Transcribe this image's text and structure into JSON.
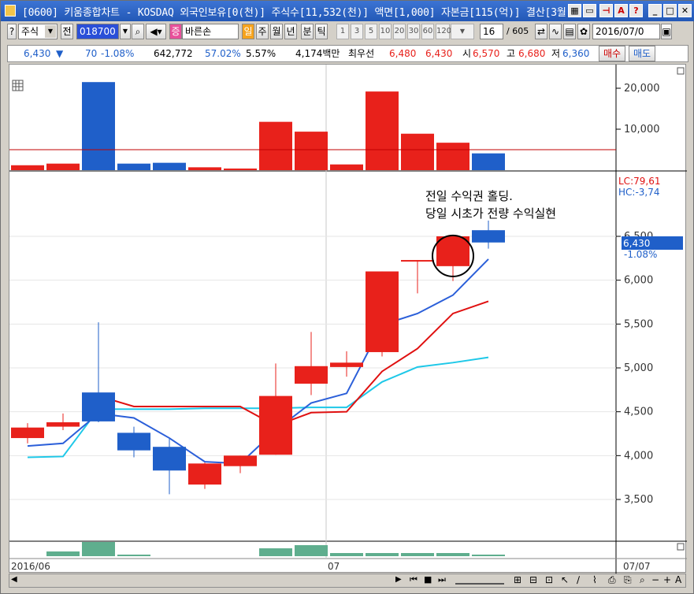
{
  "window": {
    "title": "[0600] 키움종합차트 - KOSDAQ 외국인보유[0(천)] 주식수[11,532(천)] 액면[1,000] 자본금[115(억)] 결산[3월"
  },
  "toolbar": {
    "market": "주식",
    "prev_label": "전",
    "code": "018700",
    "stock_name": "바른손",
    "badge": "증",
    "periods": [
      "일",
      "주",
      "월",
      "년",
      "분",
      "틱"
    ],
    "minutes": [
      "1",
      "3",
      "5",
      "10",
      "20",
      "30",
      "60",
      "120"
    ],
    "count": "16",
    "total": "/ 605",
    "date": "2016/07/0"
  },
  "quote": {
    "price": "6,430",
    "arrow": "▼",
    "change": "70",
    "change_pct": "-1.08%",
    "volume": "642,772",
    "ratio": "57.02%",
    "turnover": "5.57%",
    "amount": "4,174백만",
    "best_label": "최우선",
    "bid": "6,480",
    "ask": "6,430",
    "open_label": "시",
    "open": "6,570",
    "high_label": "고",
    "high": "6,680",
    "low_label": "저",
    "low": "6,360",
    "buy_label": "매수",
    "sell_label": "매도"
  },
  "annotation": {
    "line1": "전일 수익권 홀딩.",
    "line2": "당일 시초가 전량 수익실현"
  },
  "indicator": {
    "lc": "LC:79,61",
    "hc": "HC:-3,74",
    "current_price": "6,430",
    "current_pct": "-1.08%"
  },
  "axis": {
    "date_left": "2016/06",
    "date_mid": "07",
    "date_right": "07/07"
  },
  "colors": {
    "up": "#e8211b",
    "down": "#1f5fc9",
    "ma5": "#2b5fd9",
    "ma10": "#e01010",
    "ma20": "#1ec8e8",
    "vol_ref": "#c00000",
    "sub_vol": "#5fae8e"
  },
  "chart_data": {
    "type": "candlestick",
    "candles": [
      {
        "o": 4200,
        "h": 4370,
        "l": 4140,
        "c": 4320,
        "up": true
      },
      {
        "o": 4330,
        "h": 4480,
        "l": 4290,
        "c": 4380,
        "up": true
      },
      {
        "o": 4720,
        "h": 5520,
        "l": 4380,
        "c": 4390,
        "up": false
      },
      {
        "o": 4260,
        "h": 4330,
        "l": 3980,
        "c": 4060,
        "up": false
      },
      {
        "o": 4100,
        "h": 4190,
        "l": 3560,
        "c": 3830,
        "up": false
      },
      {
        "o": 3670,
        "h": 3920,
        "l": 3620,
        "c": 3910,
        "up": true
      },
      {
        "o": 3880,
        "h": 4000,
        "l": 3800,
        "c": 4000,
        "up": true
      },
      {
        "o": 4010,
        "h": 5050,
        "l": 4010,
        "c": 4680,
        "up": true
      },
      {
        "o": 4820,
        "h": 5410,
        "l": 4690,
        "c": 5020,
        "up": true
      },
      {
        "o": 5010,
        "h": 5190,
        "l": 4900,
        "c": 5060,
        "up": true
      },
      {
        "o": 5180,
        "h": 6100,
        "l": 5130,
        "c": 6100,
        "up": true
      },
      {
        "o": 6230,
        "h": 6230,
        "l": 5850,
        "c": 6230,
        "up": true
      },
      {
        "o": 6160,
        "h": 6500,
        "l": 5990,
        "c": 6500,
        "up": true
      },
      {
        "o": 6570,
        "h": 6680,
        "l": 6360,
        "c": 6430,
        "up": false
      }
    ],
    "ma5": [
      4110,
      4140,
      4480,
      4430,
      4200,
      3930,
      3910,
      4290,
      4600,
      4710,
      5490,
      5620,
      5830,
      6240
    ],
    "ma10": [
      null,
      null,
      4680,
      4560,
      4560,
      4560,
      4560,
      4340,
      4490,
      4500,
      4960,
      5220,
      5620,
      5760
    ],
    "ma20": [
      3980,
      3990,
      4530,
      4530,
      4530,
      4540,
      4540,
      4540,
      4550,
      4550,
      4840,
      5010,
      5060,
      5120
    ],
    "volumes": [
      1200,
      1600,
      21500,
      1600,
      1800,
      700,
      400,
      11800,
      9400,
      1400,
      19200,
      8900,
      6700,
      4100
    ],
    "vol_ref": 5000,
    "y_ticks": [
      "3,500",
      "4,000",
      "4,500",
      "5,000",
      "5,500",
      "6,000",
      "6,500"
    ],
    "vol_ticks": [
      "10,000",
      "20,000"
    ]
  }
}
